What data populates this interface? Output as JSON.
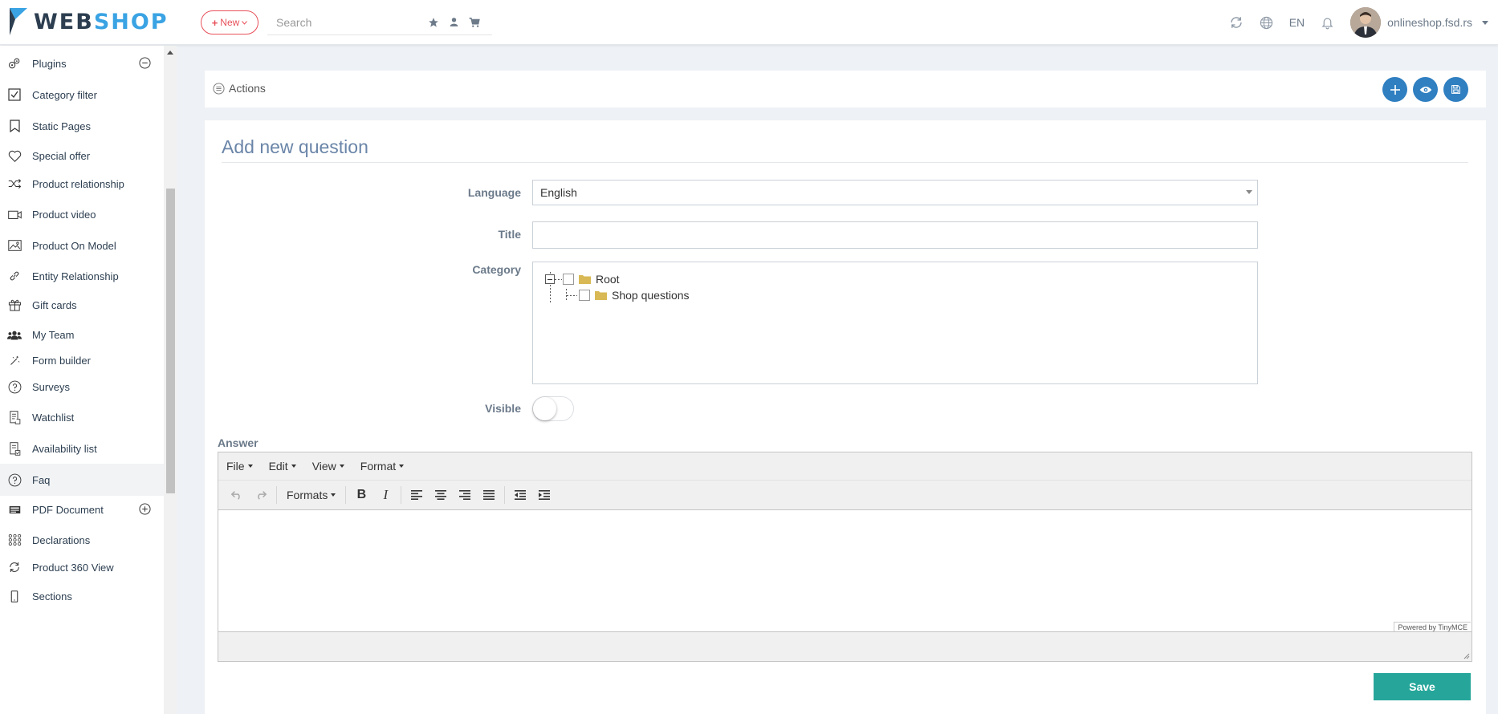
{
  "app": {
    "logo_web": "WEB",
    "logo_shop": "SHOP",
    "new_button": "New",
    "search_placeholder": "Search",
    "language": "EN",
    "user": "onlineshop.fsd.rs"
  },
  "sidebar": {
    "items": [
      {
        "label": "Plugins",
        "icon": "plugins-icon",
        "control": "collapse"
      },
      {
        "label": "Category filter",
        "icon": "checkbox-icon"
      },
      {
        "label": "Static Pages",
        "icon": "bookmark-icon"
      },
      {
        "label": "Special offer",
        "icon": "heart-icon"
      },
      {
        "label": "Product relationship",
        "icon": "shuffle-icon"
      },
      {
        "label": "Product video",
        "icon": "video-icon"
      },
      {
        "label": "Product On Model",
        "icon": "image-icon"
      },
      {
        "label": "Entity Relationship",
        "icon": "link-icon"
      },
      {
        "label": "Gift cards",
        "icon": "gift-icon"
      },
      {
        "label": "My Team",
        "icon": "team-icon"
      },
      {
        "label": "Form builder",
        "icon": "wand-icon"
      },
      {
        "label": "Surveys",
        "icon": "question-icon"
      },
      {
        "label": "Watchlist",
        "icon": "watchlist-icon"
      },
      {
        "label": "Availability list",
        "icon": "availability-icon"
      },
      {
        "label": "Faq",
        "icon": "question-icon",
        "active": true
      },
      {
        "label": "PDF Document",
        "icon": "pdf-icon",
        "control": "expand"
      },
      {
        "label": "Declarations",
        "icon": "grid-icon"
      },
      {
        "label": "Product 360 View",
        "icon": "rotate-icon"
      },
      {
        "label": "Sections",
        "icon": "mobile-icon"
      }
    ]
  },
  "actions": {
    "label": "Actions"
  },
  "form": {
    "title": "Add new question",
    "language_label": "Language",
    "language_value": "English",
    "title_label": "Title",
    "title_value": "",
    "category_label": "Category",
    "tree": {
      "root": "Root",
      "child": "Shop questions"
    },
    "visible_label": "Visible",
    "visible": false,
    "answer_label": "Answer"
  },
  "editor": {
    "menus": [
      "File",
      "Edit",
      "View",
      "Format"
    ],
    "formats_label": "Formats",
    "powered_by": "Powered by TinyMCE"
  },
  "save_label": "Save",
  "colors": {
    "accent": "#2f7fc1",
    "save": "#26a69a",
    "new": "#e7505a"
  }
}
